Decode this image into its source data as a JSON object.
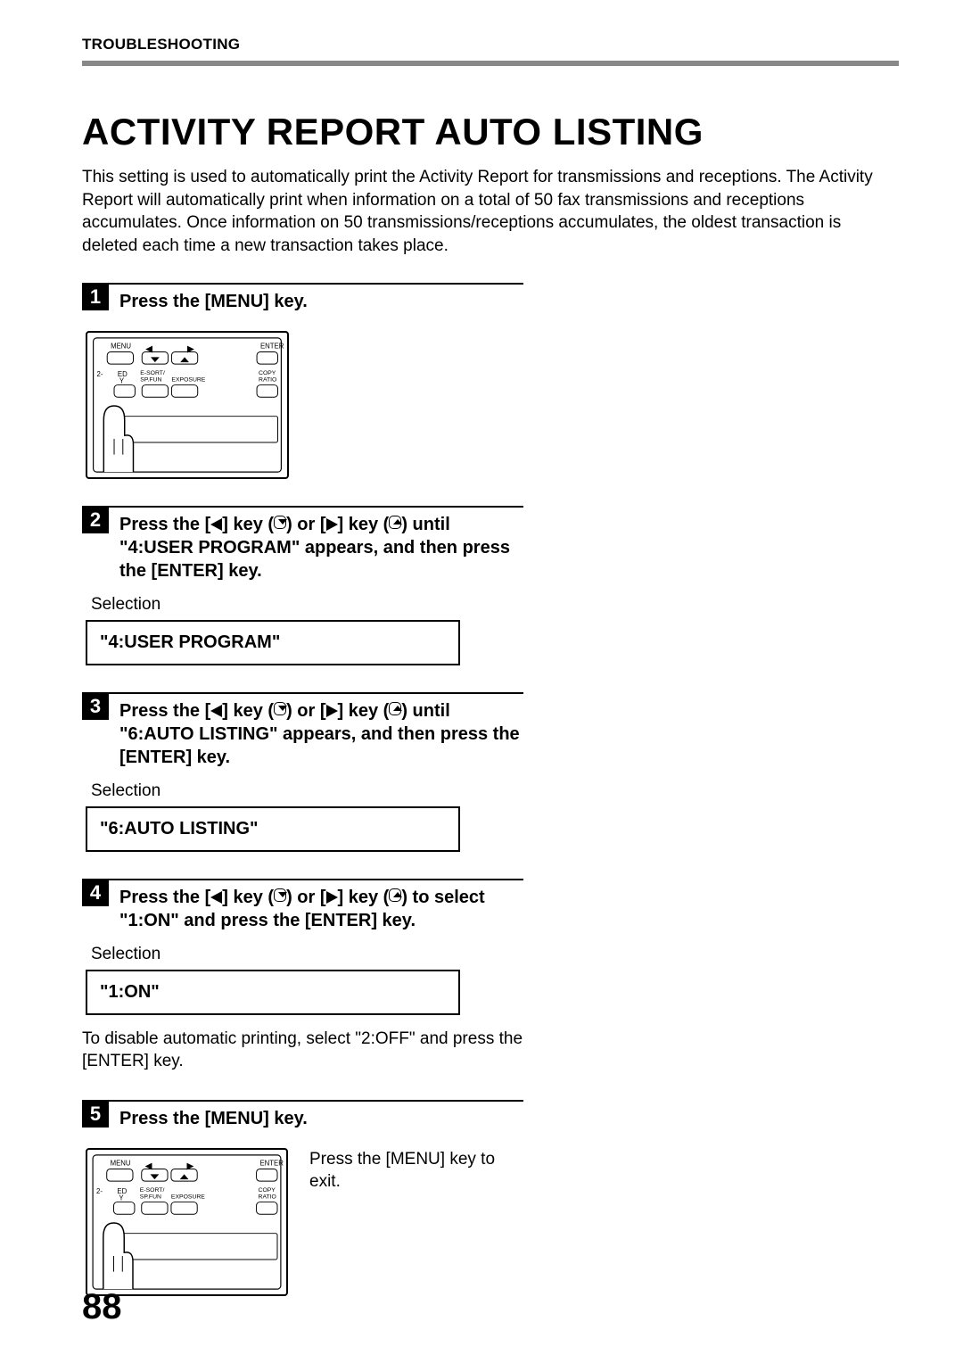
{
  "chapter": "TROUBLESHOOTING",
  "title": "ACTIVITY REPORT AUTO LISTING",
  "intro": "This setting is used to automatically print the Activity Report for transmissions and receptions. The Activity Report will automatically print when information on a total of 50 fax transmissions and receptions accumulates. Once information on 50 transmissions/receptions accumulates, the oldest transaction is deleted each time a new transaction takes place.",
  "selection_label": "Selection",
  "step1": {
    "num": "1",
    "title": "Press the [MENU] key."
  },
  "step2": {
    "num": "2",
    "pre": "Press the [",
    "mid1": "] key (",
    "mid2": ") or [",
    "mid3": "] key (",
    "post": ") until \"4:USER PROGRAM\" appears, and then press the [ENTER] key.",
    "value": "\"4:USER PROGRAM\""
  },
  "step3": {
    "num": "3",
    "post": ") until \"6:AUTO LISTING\" appears, and then press the [ENTER] key.",
    "value": "\"6:AUTO LISTING\""
  },
  "step4": {
    "num": "4",
    "post": ") to select \"1:ON\" and press the [ENTER] key.",
    "value": "\"1:ON\"",
    "note": "To disable automatic printing, select \"2:OFF\" and press the [ENTER] key."
  },
  "step5": {
    "num": "5",
    "title": "Press the [MENU] key.",
    "exit": "Press the [MENU] key to exit."
  },
  "panel": {
    "menu": "MENU",
    "enter": "ENTER",
    "ed": "ED",
    "two": "2-",
    "y": "Y",
    "esort": "E-SORT/",
    "spfun": "SP.FUN",
    "exposure": "EXPOSURE",
    "copy": "COPY",
    "ratio": "RATIO"
  },
  "page_number": "88"
}
